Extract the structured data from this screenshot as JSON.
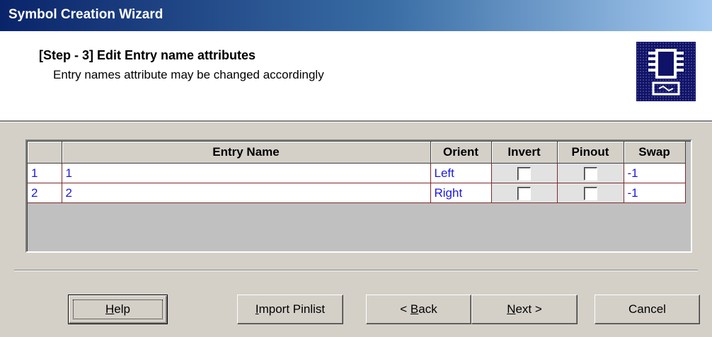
{
  "window": {
    "title": "Symbol Creation Wizard"
  },
  "header": {
    "step_title": "[Step - 3] Edit Entry name attributes",
    "step_subtitle": "Entry names attribute may be changed accordingly",
    "icon": "chip-icon"
  },
  "grid": {
    "columns": [
      "",
      "Entry Name",
      "Orient",
      "Invert",
      "Pinout",
      "Swap"
    ],
    "rows": [
      {
        "num": "1",
        "entry_name": "1",
        "orient": "Left",
        "invert": false,
        "pinout": false,
        "swap": "-1"
      },
      {
        "num": "2",
        "entry_name": "2",
        "orient": "Right",
        "invert": false,
        "pinout": false,
        "swap": "-1"
      }
    ]
  },
  "buttons": {
    "help": {
      "pre": "",
      "mnemonic": "H",
      "post": "elp"
    },
    "import": {
      "pre": "",
      "mnemonic": "I",
      "post": "mport Pinlist"
    },
    "back": {
      "pre": "< ",
      "mnemonic": "B",
      "post": "ack"
    },
    "next": {
      "pre": "",
      "mnemonic": "N",
      "post": "ext >"
    },
    "cancel": {
      "pre": "Cancel",
      "mnemonic": "",
      "post": ""
    }
  },
  "colors": {
    "title_gradient_start": "#0a246a",
    "cell_text": "#1a1adc",
    "cell_border": "#7b2b2b"
  }
}
